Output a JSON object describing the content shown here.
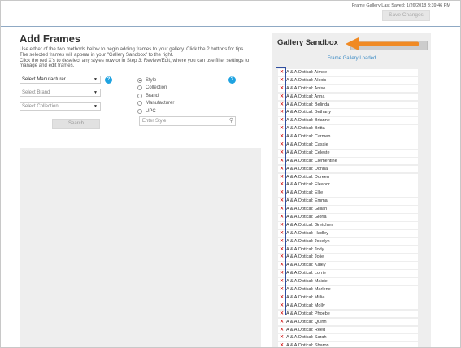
{
  "header": {
    "last_saved": "Frame Gallery Last Saved: 1/26/2018 3:39:46 PM",
    "save_label": "Save Changes"
  },
  "add_frames": {
    "title": "Add Frames",
    "instructions": [
      "Use either of the two methods below to begin adding frames to your gallery. Click the ? buttons for tips.",
      "The selected frames will appear in your \"Gallery Sandbox\" to the right.",
      "Click the red X's to deselect any styles now or in Step 3: Review/Edit, where you can use filter settings to manage and edit frames."
    ],
    "selects": {
      "manufacturer": "Select Manufacturer",
      "brand": "Select Brand",
      "collection": "Select Collection"
    },
    "help_glyph": "?",
    "search_label": "Search",
    "radio_options": [
      "Style",
      "Collection",
      "Brand",
      "Manufacturer",
      "UPC"
    ],
    "radio_selected": "Style",
    "enter_style_placeholder": "Enter Style"
  },
  "sandbox": {
    "title": "Gallery Sandbox",
    "status": "Frame Gallery Loaded",
    "remove_glyph": "✕",
    "frames": [
      "A & A Optical: Aimee",
      "A & A Optical: Alexis",
      "A & A Optical: Anise",
      "A & A Optical: Anna",
      "A & A Optical: Belinda",
      "A & A Optical: Bethany",
      "A & A Optical: Brianne",
      "A & A Optical: Britta",
      "A & A Optical: Carmen",
      "A & A Optical: Cassie",
      "A & A Optical: Celeste",
      "A & A Optical: Clementine",
      "A & A Optical: Donna",
      "A & A Optical: Doreen",
      "A & A Optical: Eleanor",
      "A & A Optical: Ellie",
      "A & A Optical: Emma",
      "A & A Optical: Gillian",
      "A & A Optical: Gloria",
      "A & A Optical: Gretchen",
      "A & A Optical: Hadley",
      "A & A Optical: Jocelyn",
      "A & A Optical: Jody",
      "A & A Optical: Jolie",
      "A & A Optical: Kaley",
      "A & A Optical: Lorrie",
      "A & A Optical: Maisie",
      "A & A Optical: Marlene",
      "A & A Optical: Millie",
      "A & A Optical: Molly",
      "A & A Optical: Phoebe",
      "A & A Optical: Quinn",
      "A & A Optical: Reed",
      "A & A Optical: Sarah",
      "A & A Optical: Sharon"
    ]
  },
  "colors": {
    "help_icon": "#1fa3e1",
    "remove_x": "#d42a2a",
    "annotation_arrow": "#f08a24",
    "annotation_box": "#2f4ea0",
    "status_text": "#3a8ac4"
  }
}
